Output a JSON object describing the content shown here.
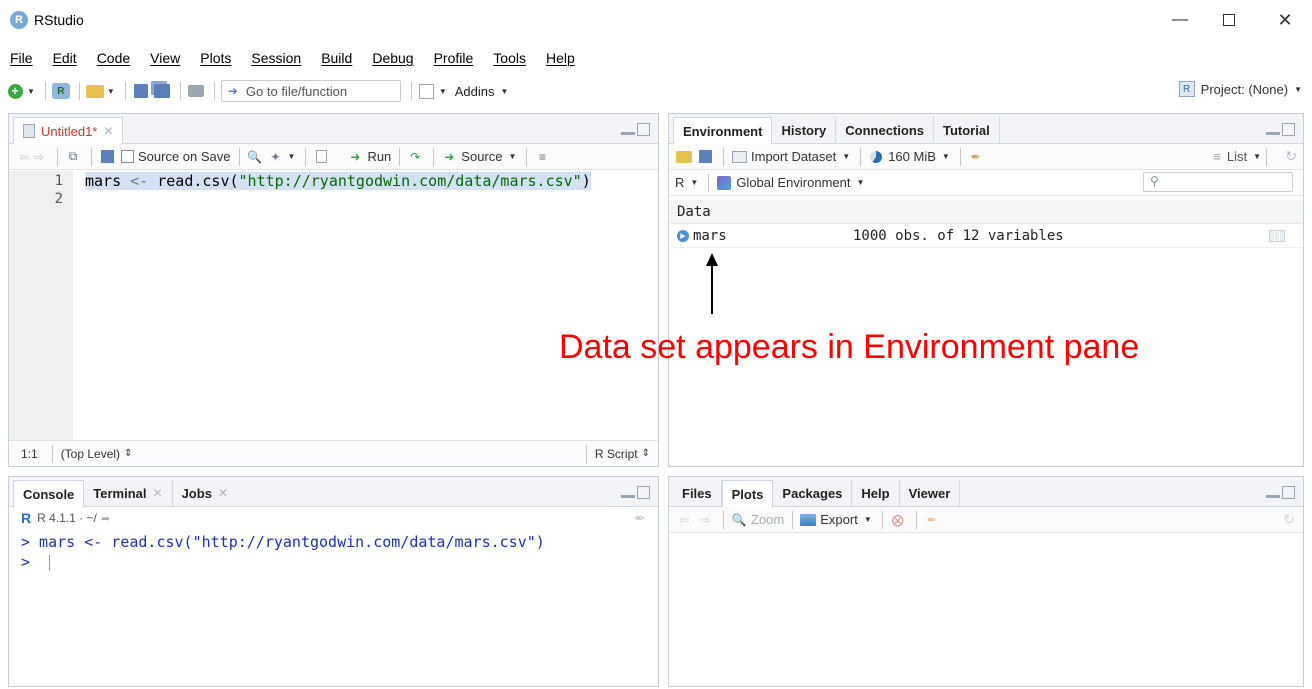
{
  "window": {
    "title": "RStudio",
    "app_icon": "R"
  },
  "menu": [
    "File",
    "Edit",
    "Code",
    "View",
    "Plots",
    "Session",
    "Build",
    "Debug",
    "Profile",
    "Tools",
    "Help"
  ],
  "toolbar": {
    "goto_placeholder": "Go to file/function",
    "addins": "Addins",
    "project": "Project: (None)"
  },
  "editor": {
    "tab": "Untitled1*",
    "source_on_save": "Source on Save",
    "run": "Run",
    "source": "Source",
    "lines": [
      "1",
      "2"
    ],
    "code_var": "mars",
    "code_op": "<-",
    "code_fn": "read.csv(",
    "code_str": "\"http://ryantgodwin.com/data/mars.csv\"",
    "code_close": ")",
    "position": "1:1",
    "scope": "(Top Level)",
    "filetype": "R Script"
  },
  "console": {
    "tabs": [
      "Console",
      "Terminal",
      "Jobs"
    ],
    "version": "R 4.1.1 · ~/",
    "lines": [
      "> mars <- read.csv(\"http://ryantgodwin.com/data/mars.csv\")",
      "> "
    ]
  },
  "environment": {
    "tabs": [
      "Environment",
      "History",
      "Connections",
      "Tutorial"
    ],
    "import_dataset": "Import Dataset",
    "memory": "160 MiB",
    "list_view": "List",
    "lang": "R",
    "scope": "Global Environment",
    "section": "Data",
    "row_name": "mars",
    "row_value": "1000 obs. of 12 variables"
  },
  "files": {
    "tabs": [
      "Files",
      "Plots",
      "Packages",
      "Help",
      "Viewer"
    ],
    "zoom": "Zoom",
    "export": "Export"
  },
  "annotation": {
    "text": "Data set appears in Environment pane",
    "color": "#ff0000"
  }
}
